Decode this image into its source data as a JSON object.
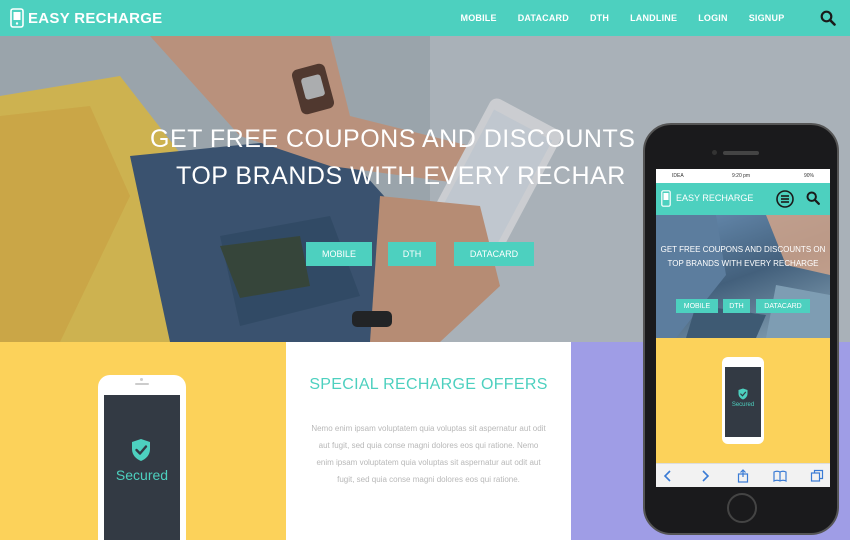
{
  "navbar": {
    "brand": "EASY RECHARGE",
    "links": [
      "MOBILE",
      "DATACARD",
      "DTH",
      "LANDLINE",
      "LOGIN",
      "SIGNUP"
    ]
  },
  "hero": {
    "headline_line1": "GET FREE COUPONS AND DISCOUNTS",
    "headline_line2": "TOP BRANDS WITH EVERY RECHAR",
    "buttons": [
      "MOBILE",
      "DTH",
      "DATACARD"
    ]
  },
  "offers": {
    "title": "SPECIAL RECHARGE OFFERS",
    "body": "Nemo enim ipsam voluptatem quia voluptas sit aspernatur aut odit aut fugit, sed quia conse magni dolores eos qui ratione. Nemo enim ipsam voluptatem quia voluptas sit aspernatur aut odit aut fugit, sed quia conse magni dolores eos qui ratione."
  },
  "mini_phone": {
    "secured_label": "Secured"
  },
  "phone_screen": {
    "carrier": "IDEA",
    "time": "9:20 pm",
    "battery": "90%",
    "brand": "EASY RECHARGE",
    "headline": "GET FREE COUPONS AND DISCOUNTS ON TOP BRANDS WITH EVERY RECHARGE",
    "buttons": [
      "MOBILE",
      "DTH",
      "DATACARD"
    ],
    "secured_label": "Secured"
  },
  "colors": {
    "accent": "#4dd0bf",
    "yellow": "#fcd25a",
    "purple": "#9f9de6",
    "text_muted": "#b8b8b8"
  },
  "icons": {
    "brand": "phone-icon",
    "search": "search-icon",
    "menu": "menu-icon",
    "shield": "shield-check-icon"
  }
}
